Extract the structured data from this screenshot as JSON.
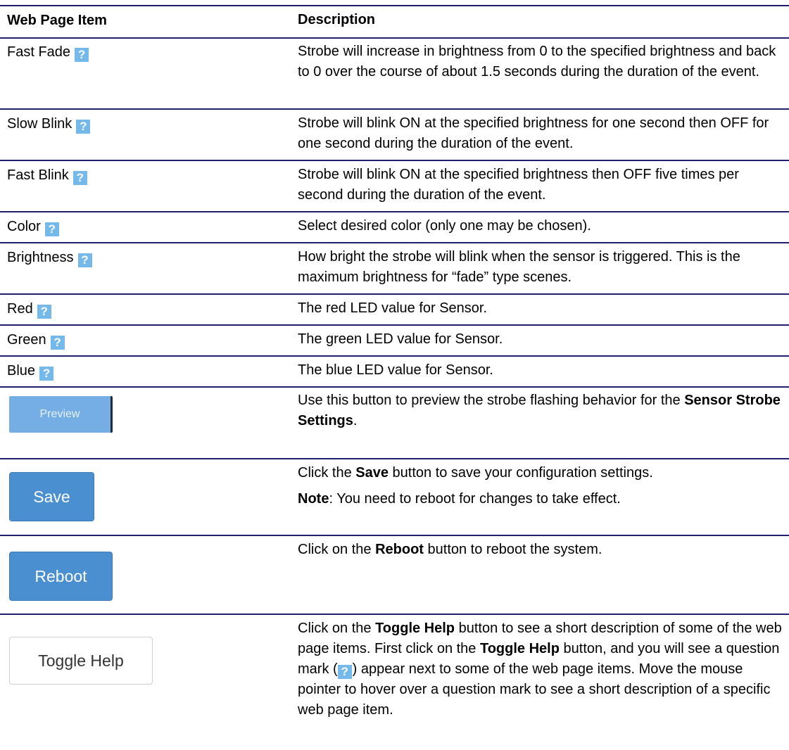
{
  "table": {
    "header": {
      "item": "Web Page Item",
      "description": "Description"
    },
    "rows": [
      {
        "item": "Fast Fade",
        "description": "Strobe will increase in brightness from 0 to the specified brightness and back to 0 over the course of about 1.5 seconds during the duration of the event."
      },
      {
        "item": "Slow Blink",
        "description": "Strobe will blink ON at the specified brightness for one second then OFF for one second during the duration of the event."
      },
      {
        "item": "Fast Blink",
        "description": "Strobe will blink ON at the specified brightness then OFF five times per second during the duration of the event."
      },
      {
        "item": "Color",
        "description": "Select desired color (only one may be chosen)."
      },
      {
        "item": "Brightness",
        "description": "How bright the strobe will blink when the sensor is triggered. This is the maximum brightness for “fade” type scenes."
      },
      {
        "item": "Red",
        "description": "The red LED value for Sensor."
      },
      {
        "item": "Green",
        "description": "The green LED value for Sensor."
      },
      {
        "item": "Blue",
        "description": "The blue LED value for Sensor."
      }
    ],
    "preview": {
      "button_label": "Preview",
      "desc_part1": "Use this button to preview the strobe flashing behavior for the ",
      "desc_bold": "Sensor Strobe Settings",
      "desc_part2": "."
    },
    "save": {
      "button_label": "Save",
      "desc_part1": "Click the ",
      "desc_bold": "Save",
      "desc_part2": " button to save your configuration settings.",
      "note_bold": "Note",
      "note_text": ": You need to reboot for changes to take effect."
    },
    "reboot": {
      "button_label": "Reboot",
      "desc_part1": "Click on the ",
      "desc_bold": "Reboot",
      "desc_part2": " button to reboot the system."
    },
    "toggle": {
      "button_label": "Toggle Help",
      "desc_part1": "Click on the ",
      "desc_bold1": "Toggle Help",
      "desc_part2": " button to see a short description of some of the web page items. First click on the ",
      "desc_bold2": "Toggle Help",
      "desc_part3": " button, and you will see a question mark (",
      "desc_part4": ") appear next to some of the web page items. Move the mouse pointer to hover over a question mark to see a short description of a specific web page item."
    }
  },
  "help_icon_glyph": "?",
  "colors": {
    "rule": "#1f1f6e",
    "help_icon": "#74b9ea",
    "button_blue": "#4a8fd0"
  }
}
